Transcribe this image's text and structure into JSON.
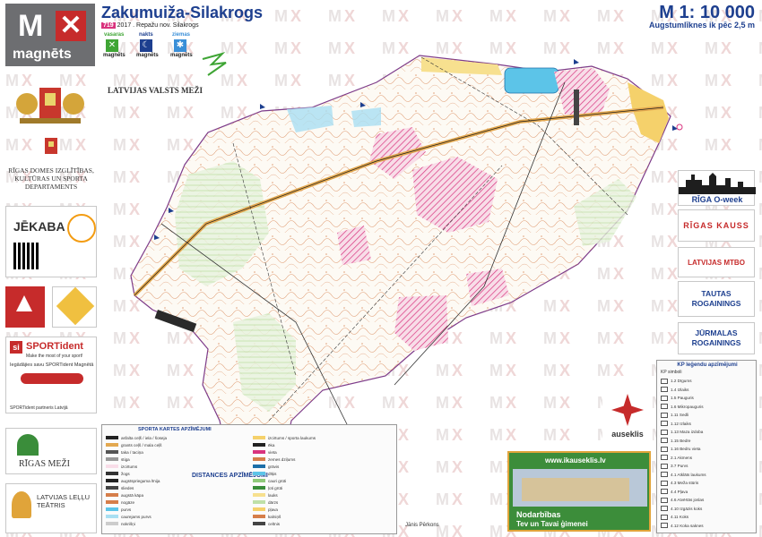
{
  "header": {
    "title": "Zakumuiža-Silakrogs",
    "subtitle": "2017 . Repažu nov. Silakrogs",
    "year_badge": "719",
    "scale": "M 1: 10 000",
    "contour": "Augstumlīknes ik pēc 2,5 m"
  },
  "seasons": [
    {
      "label": "vasaras",
      "color": "#3fa535",
      "brand": "magnēts"
    },
    {
      "label": "nakts",
      "color": "#1d3f8f",
      "brand": "magnēts"
    },
    {
      "label": "ziemas",
      "color": "#3a8fd8",
      "brand": "magnēts"
    }
  ],
  "sidebar_left": {
    "logo_text": "magnēts",
    "forest_logo": "LATVIJAS VALSTS MEŽI",
    "riga_dept": "RĪGAS DOMES IZGLĪTĪBAS, KULTŪRAS UN SPORTA DEPARTAMENTS",
    "jekaba": "JĒKABA",
    "sportident_title": "SPORTident",
    "sportident_slogan": "Make the most of your sport!",
    "sportident_note": "Iegādājies savu SPORTident Magnētā",
    "sportident_partner": "SPORTident partneris Latvijā",
    "rigas_mezi": "RĪGAS MEŽI",
    "lelles": "LATVIJAS LEĻĻU TEĀTRIS"
  },
  "sidebar_right": {
    "riga_oweek": "RĪGA O-week",
    "rigas_kauss": "RĪGAS KAUSS",
    "mtbo": "LATVIJAS MTBO",
    "tautas": "TAUTAS ROGAININGS",
    "jurmalas": "JŪRMALAS ROGAININGS",
    "auseklis": "auseklis"
  },
  "legend": {
    "title": "SPORTA KARTES APZĪMĒJUMI",
    "distance_title": "DISTANCES APZĪMĒJUMI",
    "items_col1": [
      "asfalta ceļš / iela / šoseja",
      "grants ceļš / mala ceļš",
      "taka / taciņa",
      "stiga",
      "izcirtums",
      "žogs",
      "augstsprieguma līnija",
      "sliedes",
      "augstā kāpa",
      "nogāze",
      "purvs",
      "caurejams purvs",
      "nokrišņi"
    ],
    "items_col2": [
      "izcirtums / sporta laukums",
      "ēka",
      "vieta",
      "zemes dziļums",
      "grāvis",
      "dīķis",
      "cauri grūti",
      "ļoti grūti",
      "lauks",
      "dārzs",
      "pļava",
      "kalniņš",
      "celtnis"
    ]
  },
  "kp_legend": {
    "title": "KP leģendu apzīmējumi",
    "subtitle": "KP simboli",
    "items": [
      "1.2 Dīgums",
      "1.4 Izlaiks",
      "1.5 Pauguris",
      "1.6 Mikropauguris",
      "1.11 Sedli",
      "1.12 Izlaiks",
      "1.13 Maza izdoba",
      "1.15 Bedre",
      "1.16 Bedru vieta",
      "2.1 Akmens",
      "3.7 Purvs",
      "4.1 Atklāts laukums",
      "4.3 Meža stūris",
      "4.4 Pļava",
      "4.6 Atvērtās joslas",
      "4.10 Izgāzis koks",
      "4.11 Koks",
      "4.12 Koka saknes"
    ]
  },
  "ad": {
    "url": "www.ikauseklis.lv",
    "line1": "Nodarbības",
    "line2": "Tev un Tavai ģimenei"
  },
  "footer": {
    "credits": "Jānis Pērkons"
  }
}
